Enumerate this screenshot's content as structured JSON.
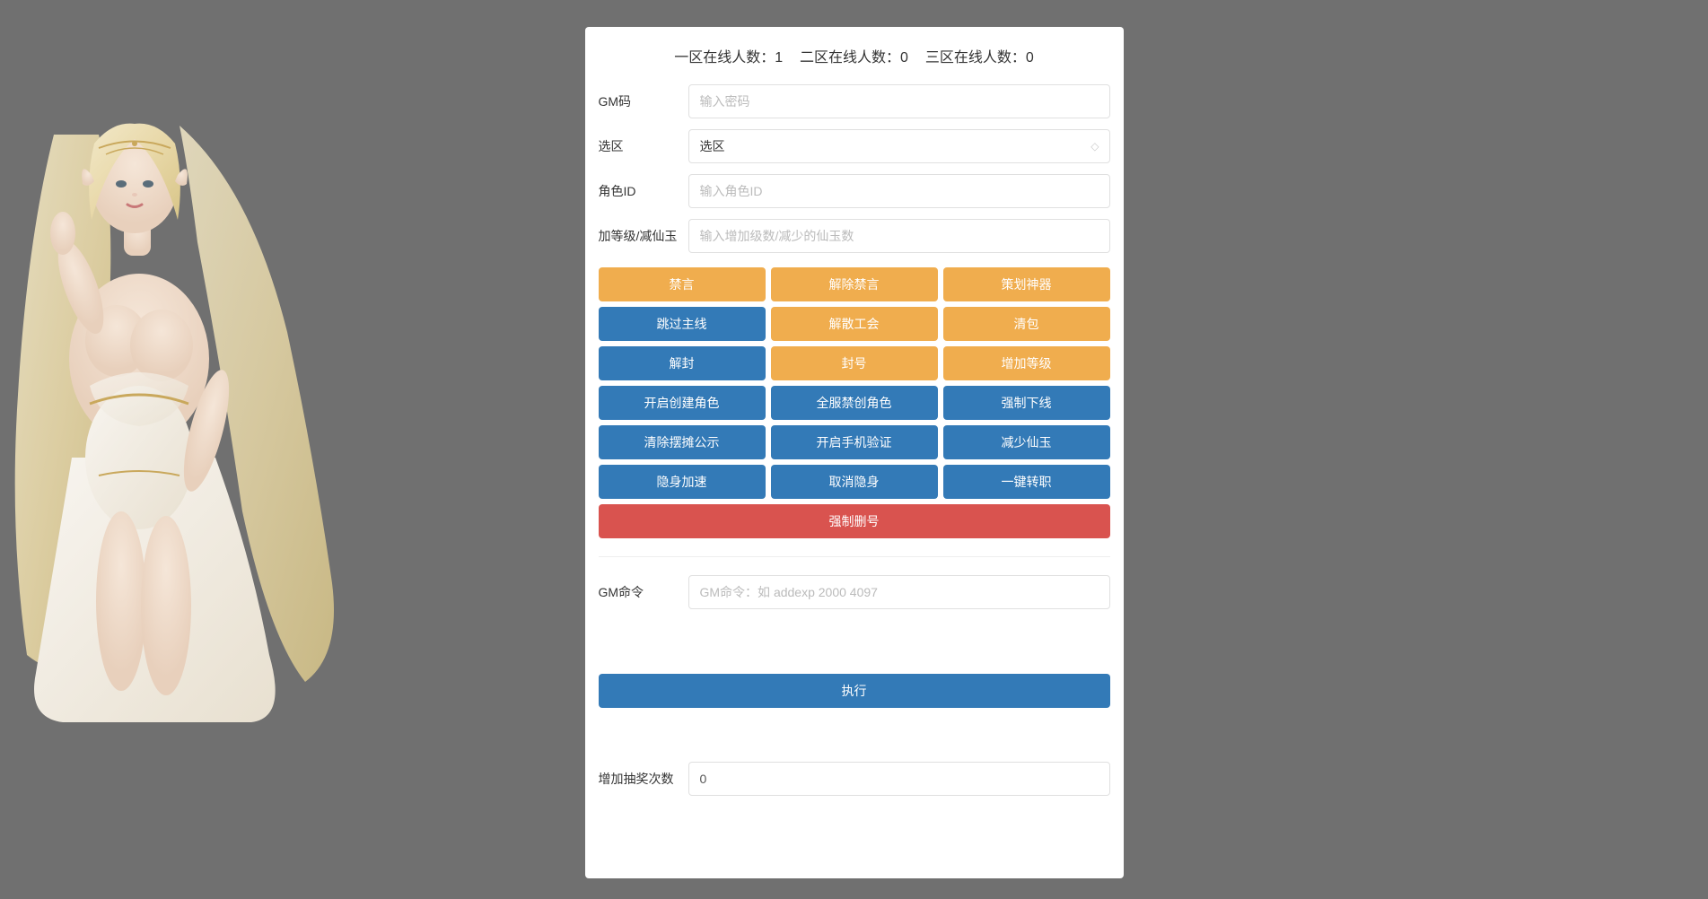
{
  "online": {
    "zone1_label": "一区在线人数：",
    "zone1_count": "1",
    "zone2_label": "二区在线人数：",
    "zone2_count": "0",
    "zone3_label": "三区在线人数：",
    "zone3_count": "0"
  },
  "form": {
    "gm_code_label": "GM码",
    "gm_code_placeholder": "输入密码",
    "zone_label": "选区",
    "zone_selected": "选区",
    "role_id_label": "角色ID",
    "role_id_placeholder": "输入角色ID",
    "level_jade_label": "加等级/减仙玉",
    "level_jade_placeholder": "输入增加级数/减少的仙玉数"
  },
  "buttons": {
    "row1": [
      "禁言",
      "解除禁言",
      "策划神器"
    ],
    "row2": [
      "跳过主线",
      "解散工会",
      "清包"
    ],
    "row3": [
      "解封",
      "封号",
      "增加等级"
    ],
    "row4": [
      "开启创建角色",
      "全服禁创角色",
      "强制下线"
    ],
    "row5": [
      "清除摆摊公示",
      "开启手机验证",
      "减少仙玉"
    ],
    "row6": [
      "隐身加速",
      "取消隐身",
      "一键转职"
    ],
    "row7": "强制删号"
  },
  "gm_command": {
    "label": "GM命令",
    "placeholder": "GM命令：如 addexp 2000 4097",
    "execute": "执行"
  },
  "lottery": {
    "label": "增加抽奖次数",
    "value": "0"
  }
}
